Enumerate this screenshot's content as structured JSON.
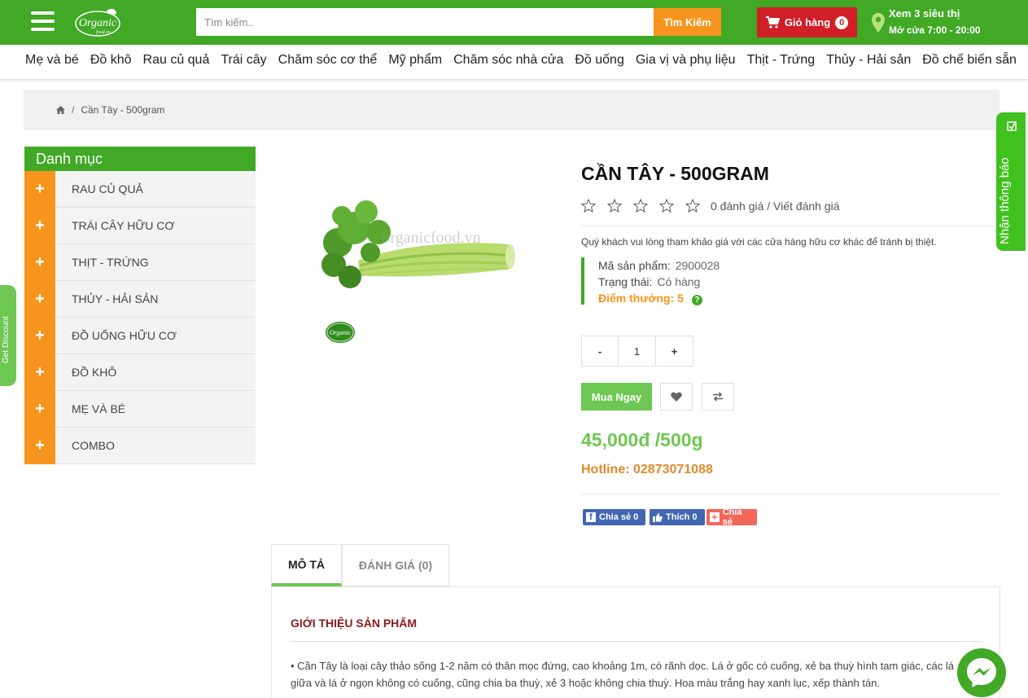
{
  "header": {
    "search_placeholder": "Tìm kiếm..",
    "search_button": "Tìm Kiếm",
    "cart_label": "Giỏ hàng",
    "cart_count": "0",
    "store_title": "Xem 3 siêu thị",
    "store_hours": "Mở cửa 7:00 - 20:00",
    "logo_text": "Organic",
    "logo_subtext": "food.vn"
  },
  "categories": [
    "Mẹ và bé",
    "Đồ khô",
    "Rau củ quả",
    "Trái cây",
    "Chăm sóc cơ thể",
    "Mỹ phẩm",
    "Chăm sóc nhà cửa",
    "Đồ uống",
    "Gia vị và phụ liệu",
    "Thịt - Trứng",
    "Thủy - Hải sản",
    "Đồ chế biến sẵn"
  ],
  "breadcrumb": {
    "current": "Cần Tây - 500gram"
  },
  "sidebar": {
    "title": "Danh mục",
    "items": [
      "RAU CỦ QUẢ",
      "TRÁI CÂY HỮU CƠ",
      "THỊT - TRỨNG",
      "THỦY - HẢI SẢN",
      "ĐỒ UỐNG HỮU CƠ",
      "ĐỒ KHÔ",
      "MẸ VÀ BÉ",
      "COMBO"
    ]
  },
  "product": {
    "title": "CẦN TÂY - 500GRAM",
    "rating_text": "0 đánh giá / Viết đánh giá",
    "note": "Quý khách vui lòng tham khảo giá với các cửa hàng hữu cơ khác để tránh bị thiệt.",
    "sku_label": "Mã sản phẩm:",
    "sku": "2900028",
    "status_label": "Trạng thái:",
    "status": "Có hàng",
    "points": "Điểm thưởng: 5",
    "quantity": "1",
    "qty_minus": "-",
    "qty_plus": "+",
    "buy_button": "Mua Ngay",
    "price": "45,000đ /500g",
    "hotline": "Hotline: 02873071088",
    "watermark": "organicfood.vn",
    "image_logo": "Organic"
  },
  "share": {
    "facebook_share": "Chia sẻ 0",
    "facebook_like": "Thích 0",
    "share": "Chia sẻ"
  },
  "tabs": {
    "description": "MÔ TẢ",
    "reviews": "ĐÁNH GIÁ (0)"
  },
  "description": {
    "heading": "GIỚI THIỆU SẢN PHẨM",
    "text": "• Cần Tây là loại cây thảo sống 1-2 năm có thân mọc đứng, cao khoảng 1m, có rãnh dọc. Lá ở gốc có cuống, xẻ ba thuỳ hình tam giác, các lá giữa và lá ở ngọn không có cuống, cũng chia ba thuỳ, xẻ 3 hoặc không chia thuỳ. Hoa màu trắng hay xanh lục, xếp thành tán."
  },
  "floating": {
    "notify": "Nhận thông báo",
    "discount": "Get Discount"
  },
  "colors": {
    "brand_green": "#41a925",
    "accent_orange": "#f7941d",
    "cart_red": "#d01f27",
    "price_green": "#6dc752"
  }
}
